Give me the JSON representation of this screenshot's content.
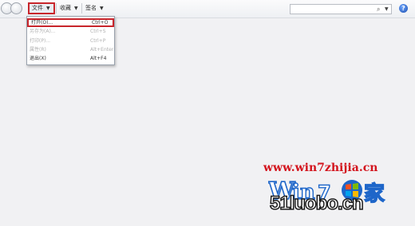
{
  "toolbar": {
    "menus": [
      {
        "label": "文件"
      },
      {
        "label": "收藏"
      },
      {
        "label": "签名"
      }
    ],
    "search": {
      "value": "",
      "placeholder": ""
    },
    "caret": "▼"
  },
  "file_menu": {
    "items": [
      {
        "label": "打开(O)...",
        "shortcut": "Ctrl+O"
      },
      {
        "label": "另存为(A)...",
        "shortcut": "Ctrl+S"
      },
      {
        "label": "打印(P)...",
        "shortcut": "Ctrl+P"
      },
      {
        "label": "属性(R)",
        "shortcut": "Alt+Enter"
      },
      {
        "label": "退出(X)",
        "shortcut": "Alt+F4"
      }
    ]
  },
  "watermark": {
    "url": "www.win7zhijia.cn",
    "site": "51luobo.cn",
    "logo_text": "Win7之家"
  },
  "colors": {
    "highlight_red": "#c8252b",
    "watermark_red": "#d3141d",
    "watermark_blue": "#1e66c9"
  },
  "icons": {
    "back": "back-arrow-icon",
    "forward": "forward-arrow-icon",
    "search": "magnifier-icon",
    "help": "help-icon"
  }
}
